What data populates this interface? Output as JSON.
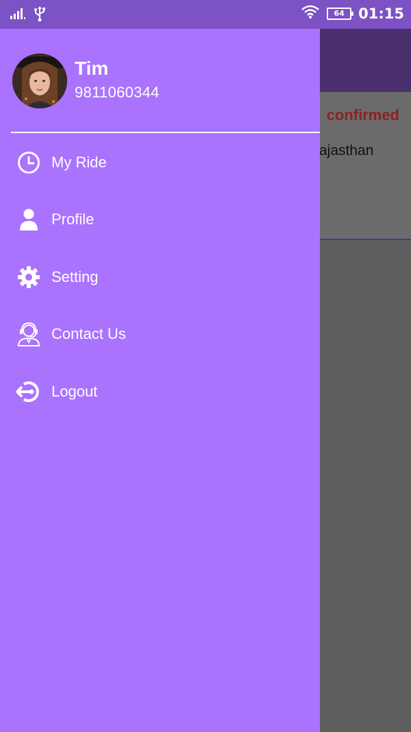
{
  "status_bar": {
    "battery_level": "64",
    "time": "01:15"
  },
  "background": {
    "ride_status": "confirmed",
    "ride_address_fragment": "ajasthan"
  },
  "drawer": {
    "user": {
      "name": "Tim",
      "phone": "9811060344"
    },
    "menu": [
      {
        "label": "My Ride",
        "icon": "clock-icon"
      },
      {
        "label": "Profile",
        "icon": "person-icon"
      },
      {
        "label": "Setting",
        "icon": "gear-icon"
      },
      {
        "label": "Contact Us",
        "icon": "support-agent-icon"
      },
      {
        "label": "Logout",
        "icon": "logout-icon"
      }
    ]
  },
  "colors": {
    "drawer_bg": "#aa73fd",
    "status_bar_bg": "#7c52c4",
    "scrim": "#5f5f5f",
    "status_text": "#8c2222"
  }
}
